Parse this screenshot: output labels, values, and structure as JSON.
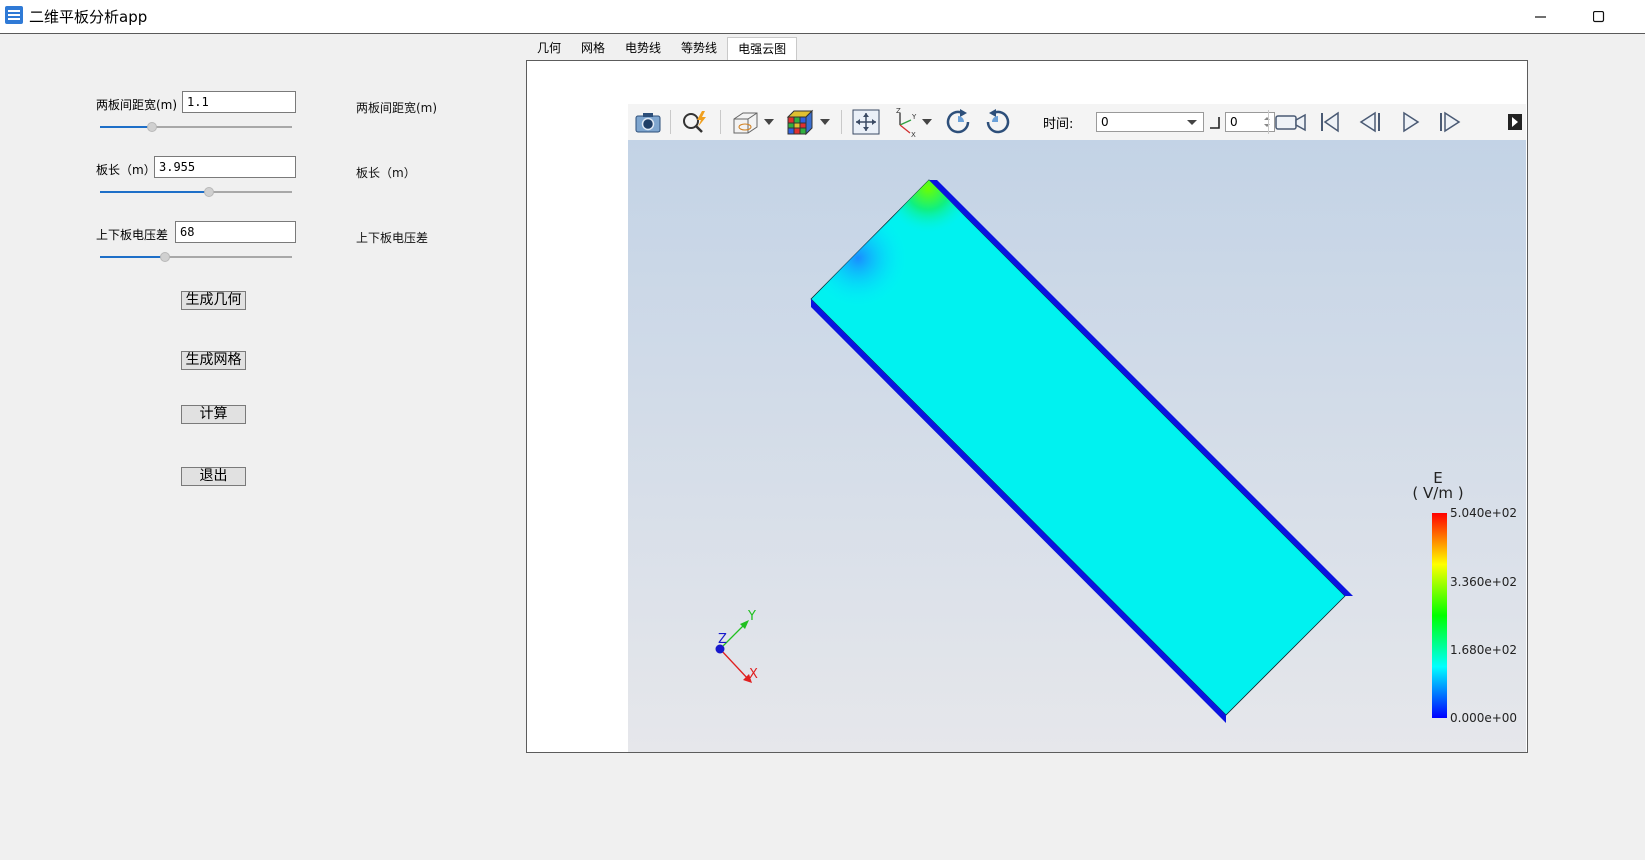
{
  "window": {
    "title": "二维平板分析app",
    "icon": "app-icon",
    "controls": [
      "minimize-icon",
      "maximize-icon"
    ]
  },
  "params": [
    {
      "label": "两板间距宽(m)",
      "value": "1.1",
      "slider_fraction": 0.27,
      "description": "两板间距宽(m)"
    },
    {
      "label": "板长（m）",
      "value": "3.955",
      "slider_fraction": 0.57,
      "description": "板长（m）"
    },
    {
      "label": "上下板电压差",
      "value": "68",
      "slider_fraction": 0.34,
      "description": "上下板电压差"
    }
  ],
  "buttons": {
    "generate_geometry": "生成几何",
    "generate_mesh": "生成网格",
    "compute": "计算",
    "exit": "退出"
  },
  "tabs": [
    {
      "label": "几何",
      "active": false
    },
    {
      "label": "网格",
      "active": false
    },
    {
      "label": "电势线",
      "active": false
    },
    {
      "label": "等势线",
      "active": false
    },
    {
      "label": "电强云图",
      "active": true
    }
  ],
  "toolbar": {
    "time_label": "时间:",
    "time_value": "0",
    "step_value": "0"
  },
  "colorbar": {
    "title": "E",
    "unit": "( V/m )",
    "ticks": [
      "5.040e+02",
      "3.360e+02",
      "1.680e+02",
      "0.000e+00"
    ],
    "colors": [
      "#ff0000",
      "#ffff00",
      "#00ff00",
      "#00ffff",
      "#0000ff"
    ]
  },
  "axes_triad": {
    "x": "X",
    "y": "Y",
    "z": "Z"
  }
}
